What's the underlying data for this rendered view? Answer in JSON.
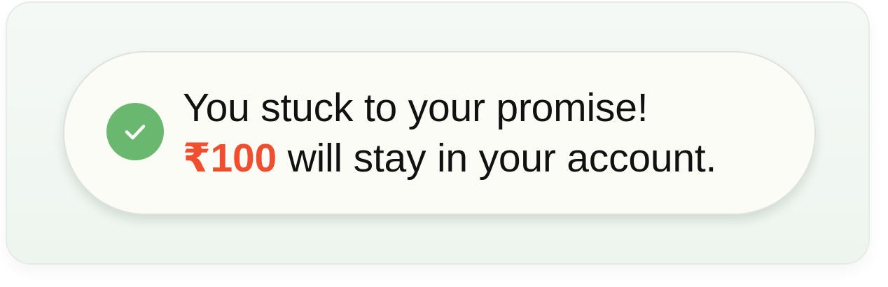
{
  "colors": {
    "success": "#6ab86f",
    "amount": "#f04e2f",
    "text": "#111111",
    "pill_background": "#fbfcf6"
  },
  "icon": "check-circle-icon",
  "message": {
    "line1": "You stuck to your promise!",
    "amount": "₹100",
    "line2_rest": " will stay in your account."
  }
}
